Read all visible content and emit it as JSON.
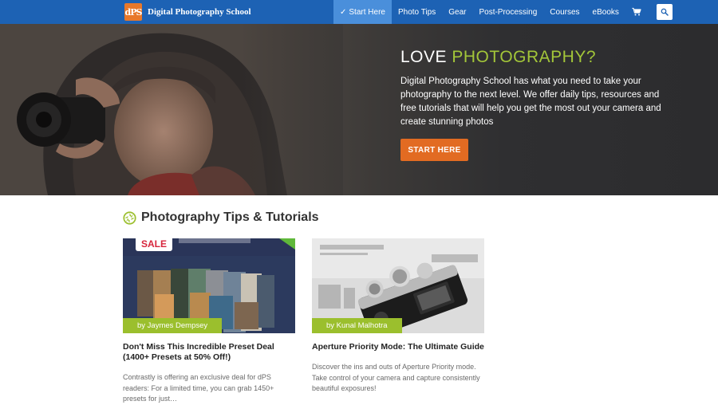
{
  "brand": {
    "logo_text": "dPS",
    "name": "Digital Photography School"
  },
  "nav": {
    "items": [
      {
        "label": "Start Here",
        "check": "✓"
      },
      {
        "label": "Photo Tips"
      },
      {
        "label": "Gear"
      },
      {
        "label": "Post-Processing"
      },
      {
        "label": "Courses"
      },
      {
        "label": "eBooks"
      }
    ],
    "cart_icon": "cart-icon",
    "search_icon": "search-icon"
  },
  "hero": {
    "title_part1": "LOVE ",
    "title_part2": "PHOTOGRAPHY?",
    "description": "Digital Photography School has what you need to take your photography to the next level. We offer daily tips, resources and free tutorials that will help you get the most out your camera and create stunning photos",
    "button_label": "START HERE"
  },
  "section": {
    "icon": "aperture-icon",
    "title": "Photography Tips & Tutorials"
  },
  "cards": [
    {
      "author": "by Jaymes Dempsey",
      "title": "Don't Miss This Incredible Preset Deal (1400+ Presets at 50% Off!)",
      "excerpt": "Contrastly is offering an exclusive deal for dPS readers: For a limited time, you can grab 1450+ presets for just…",
      "sale_text": "SALE"
    },
    {
      "author": "by Kunal Malhotra",
      "title": "Aperture Priority Mode: The Ultimate Guide",
      "excerpt": "Discover the ins and outs of Aperture Priority mode. Take control of your camera and capture consistently beautiful exposures!"
    }
  ],
  "colors": {
    "nav_bg": "#1d62b4",
    "nav_active": "#4a8fdb",
    "accent_green": "#a3c639",
    "button_orange": "#e26b22",
    "byline_green": "#9bbf2d"
  }
}
